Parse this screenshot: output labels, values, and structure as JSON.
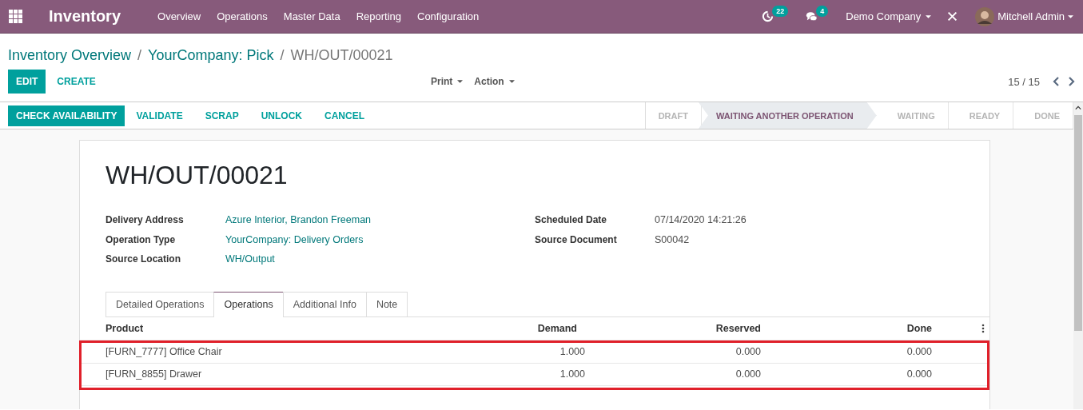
{
  "navbar": {
    "app_name": "Inventory",
    "menus": [
      "Overview",
      "Operations",
      "Master Data",
      "Reporting",
      "Configuration"
    ],
    "activity_count": "22",
    "message_count": "4",
    "company": "Demo Company",
    "user": "Mitchell Admin"
  },
  "breadcrumb": {
    "separator": "/",
    "items": [
      {
        "label": "Inventory Overview",
        "kind": "link"
      },
      {
        "label": "YourCompany: Pick",
        "kind": "link"
      },
      {
        "label": "WH/OUT/00021",
        "kind": "current"
      }
    ]
  },
  "control_panel": {
    "buttons": [
      {
        "label": "EDIT",
        "kind": "primary"
      },
      {
        "label": "CREATE",
        "kind": "link"
      }
    ],
    "dropdowns": [
      "Print",
      "Action"
    ],
    "pager": "15 / 15"
  },
  "status_bar": {
    "actions": [
      {
        "label": "CHECK AVAILABILITY",
        "kind": "primary"
      },
      {
        "label": "VALIDATE",
        "kind": "link"
      },
      {
        "label": "SCRAP",
        "kind": "link"
      },
      {
        "label": "UNLOCK",
        "kind": "link"
      },
      {
        "label": "CANCEL",
        "kind": "link"
      }
    ],
    "stages": [
      {
        "label": "DRAFT",
        "selected": false
      },
      {
        "label": "WAITING ANOTHER OPERATION",
        "selected": true
      },
      {
        "label": "WAITING",
        "selected": false
      },
      {
        "label": "READY",
        "selected": false
      },
      {
        "label": "DONE",
        "selected": false
      }
    ]
  },
  "sheet": {
    "title": "WH/OUT/00021",
    "left_fields": [
      {
        "label": "Delivery Address",
        "value": "Azure Interior, Brandon Freeman",
        "kind": "link"
      },
      {
        "label": "Operation Type",
        "value": "YourCompany: Delivery Orders",
        "kind": "link"
      },
      {
        "label": "Source Location",
        "value": "WH/Output",
        "kind": "link"
      }
    ],
    "right_fields": [
      {
        "label": "Scheduled Date",
        "value": "07/14/2020 14:21:26",
        "kind": "text"
      },
      {
        "label": "Source Document",
        "value": "S00042",
        "kind": "text"
      }
    ],
    "tabs": [
      {
        "label": "Detailed Operations",
        "selected": false
      },
      {
        "label": "Operations",
        "selected": true
      },
      {
        "label": "Additional Info",
        "selected": false
      },
      {
        "label": "Note",
        "selected": false
      }
    ],
    "table": {
      "columns": [
        "Product",
        "Demand",
        "Reserved",
        "Done"
      ],
      "rows": [
        {
          "cells": [
            "[FURN_7777] Office Chair",
            "1.000",
            "0.000",
            "0.000"
          ],
          "highlighted": true
        },
        {
          "cells": [
            "[FURN_8855] Drawer",
            "1.000",
            "0.000",
            "0.000"
          ],
          "highlighted": true
        }
      ]
    }
  }
}
